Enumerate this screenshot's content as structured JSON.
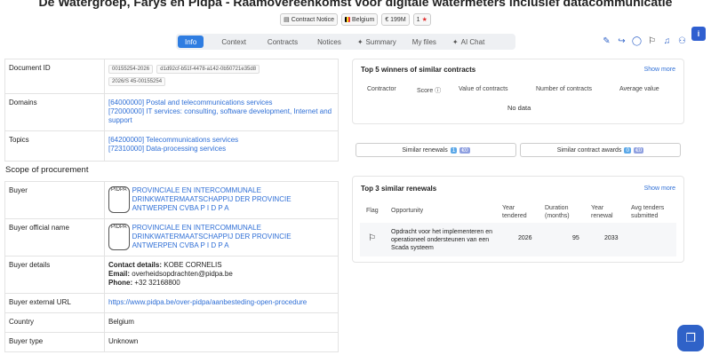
{
  "title": "De Watergroep, Farys en Pidpa - Raamovereenkomst voor digitale watermeters inclusief datacommunicatie",
  "badges": {
    "notice": "Contract Notice",
    "country": "Belgium",
    "value": "€ 199M",
    "stars": "1"
  },
  "tabs": [
    {
      "label": "Info",
      "active": true
    },
    {
      "label": "Context"
    },
    {
      "label": "Contracts"
    },
    {
      "label": "Notices"
    },
    {
      "label": "Summary"
    },
    {
      "label": "My files"
    },
    {
      "label": "AI Chat"
    }
  ],
  "icons": {
    "summary": "sparkle-icon",
    "ai_chat": "sparkle-icon",
    "info": "i"
  },
  "top_table": {
    "document_id_label": "Document ID",
    "document_ids": [
      "00155254-2026",
      "d1d92cf-b51f-4478-a142-0b50721e35d8",
      "2026/S 45-00155254"
    ],
    "domains_label": "Domains",
    "domains": [
      "[64000000] Postal and telecommunications services",
      "[72000000] IT services: consulting, software development, Internet and support"
    ],
    "topics_label": "Topics",
    "topics": [
      "[64200000] Telecommunications services",
      "[72310000] Data-processing services"
    ]
  },
  "scope_heading": "Scope of procurement",
  "scope_table": {
    "buyer_label": "Buyer",
    "buyer_seal": "PIDPA",
    "buyer_value": "PROVINCIALE EN INTERCOMMUNALE DRINKWATERMAATSCHAPPIJ DER PROVINCIE ANTWERPEN CVBA P I D P A",
    "buyer_official_label": "Buyer official name",
    "buyer_official_value": "PROVINCIALE EN INTERCOMMUNALE DRINKWATERMAATSCHAPPIJ DER PROVINCIE ANTWERPEN CVBA P I D P A",
    "buyer_details_label": "Buyer details",
    "contact_label": "Contact details:",
    "contact_value": "KOBE CORNELIS",
    "email_label": "Email:",
    "email_value": "overheidsopdrachten@pidpa.be",
    "phone_label": "Phone:",
    "phone_value": "+32 32168800",
    "external_url_label": "Buyer external URL",
    "external_url": "https://www.pidpa.be/over-pidpa/aanbesteding-open-procedure",
    "country_label": "Country",
    "country_value": "Belgium",
    "buyer_type_label": "Buyer type",
    "buyer_type_value": "Unknown"
  },
  "winners": {
    "title": "Top 5 winners of similar contracts",
    "show_more": "Show more",
    "columns": [
      "Contractor",
      "Score",
      "Value of contracts",
      "Number of contracts",
      "Average value"
    ],
    "empty": "No data"
  },
  "similar_buttons": {
    "renewals_label": "Similar renewals",
    "renewals_count": "1",
    "renewals_value": "€0",
    "awards_label": "Similar contract awards",
    "awards_count": "0",
    "awards_value": "€0"
  },
  "renewals": {
    "title": "Top 3 similar renewals",
    "show_more": "Show more",
    "columns": [
      "Flag",
      "Opportunity",
      "Year tendered",
      "Duration (months)",
      "Year renewal",
      "Avg tenders submitted"
    ],
    "rows": [
      {
        "opportunity": "Opdracht voor het implementeren en operationeel ondersteunen van een Scada systeem",
        "year_tendered": "2026",
        "duration": "95",
        "year_renewal": "2033",
        "avg_tenders": ""
      }
    ]
  }
}
